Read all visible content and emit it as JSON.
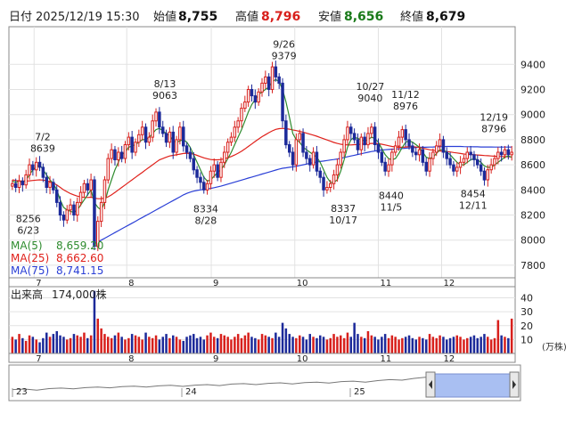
{
  "header": {
    "date_label": "日付",
    "datetime": "2025/12/19 15:30",
    "open_label": "始値",
    "open": "8,755",
    "high_label": "高値",
    "high": "8,796",
    "low_label": "安値",
    "low": "8,656",
    "close_label": "終値",
    "close": "8,679"
  },
  "colors": {
    "up": "#d8201c",
    "down": "#1c2a9a",
    "ma5": "#2e8b2e",
    "ma25": "#e0201a",
    "ma75": "#2a3fd6",
    "high": "#d8201c",
    "low": "#1a7a1a",
    "navigator_fill": "#a9bff2"
  },
  "legend": {
    "ma5": {
      "label": "MA(5)",
      "value": "8,659.20"
    },
    "ma25": {
      "label": "MA(25)",
      "value": "8,662.60"
    },
    "ma75": {
      "label": "MA(75)",
      "value": "8,741.15"
    }
  },
  "volume_panel": {
    "title": "出来高",
    "value": "174,000株",
    "unit": "(万株)",
    "y_ticks": [
      "40",
      "30",
      "20",
      "10"
    ]
  },
  "chart_data": {
    "type": "candlestick",
    "title": "",
    "xlabel": "",
    "ylabel": "",
    "ylim": [
      7700,
      9700
    ],
    "y_ticks": [
      7800,
      8000,
      8200,
      8400,
      8600,
      8800,
      9000,
      9200,
      9400
    ],
    "x_month_ticks": [
      "7",
      "8",
      "9",
      "10",
      "11",
      "12"
    ],
    "navigator_year_ticks": [
      "23",
      "24",
      "25"
    ],
    "annotations": [
      {
        "date": "6/23",
        "value": "8256",
        "position": "below"
      },
      {
        "date": "7/2",
        "value": "8639",
        "position": "above"
      },
      {
        "date": "8/13",
        "value": "9063",
        "position": "above"
      },
      {
        "date": "8/28",
        "value": "8334",
        "position": "below"
      },
      {
        "date": "9/26",
        "value": "9379",
        "position": "above"
      },
      {
        "date": "10/17",
        "value": "8337",
        "position": "below"
      },
      {
        "date": "10/27",
        "value": "9040",
        "position": "above"
      },
      {
        "date": "11/5",
        "value": "8440",
        "position": "below"
      },
      {
        "date": "11/12",
        "value": "8976",
        "position": "above"
      },
      {
        "date": "12/11",
        "value": "8454",
        "position": "below"
      },
      {
        "date": "12/19",
        "value": "8796",
        "position": "above"
      }
    ],
    "close_series": [
      8450,
      8420,
      8470,
      8440,
      8520,
      8600,
      8560,
      8620,
      8580,
      8500,
      8420,
      8460,
      8400,
      8300,
      8200,
      8160,
      8240,
      8280,
      8200,
      8300,
      8380,
      8450,
      8400,
      8480,
      7950,
      8150,
      8300,
      8480,
      8650,
      8720,
      8640,
      8700,
      8650,
      8760,
      8820,
      8700,
      8780,
      8840,
      8900,
      8780,
      8820,
      8950,
      9020,
      8900,
      8850,
      8780,
      8860,
      8700,
      8800,
      8900,
      8750,
      8700,
      8650,
      8560,
      8500,
      8460,
      8400,
      8450,
      8550,
      8600,
      8500,
      8620,
      8700,
      8780,
      8820,
      8900,
      8950,
      9050,
      9100,
      9200,
      9150,
      9100,
      9180,
      9250,
      9300,
      9200,
      9380,
      9300,
      9250,
      8950,
      8760,
      8700,
      8600,
      8800,
      8850,
      8700,
      8650,
      8600,
      8700,
      8550,
      8500,
      8400,
      8420,
      8450,
      8520,
      8600,
      8700,
      8800,
      8900,
      8850,
      8800,
      8720,
      8820,
      8760,
      8850,
      8900,
      8760,
      8700,
      8620,
      8550,
      8600,
      8700,
      8750,
      8820,
      8880,
      8800,
      8750,
      8700,
      8680,
      8720,
      8620,
      8550,
      8650,
      8700,
      8750,
      8800,
      8700,
      8650,
      8600,
      8550,
      8580,
      8620,
      8650,
      8700,
      8680,
      8640,
      8600,
      8550,
      8480,
      8560,
      8600,
      8650,
      8700,
      8680,
      8720,
      8680,
      8700
    ],
    "ma5_series": [
      8470,
      8460,
      8470,
      8460,
      8480,
      8520,
      8560,
      8580,
      8600,
      8560,
      8520,
      8480,
      8450,
      8400,
      8320,
      8260,
      8240,
      8230,
      8220,
      8240,
      8280,
      8320,
      8360,
      8400,
      8300,
      8260,
      8240,
      8300,
      8400,
      8480,
      8560,
      8620,
      8680,
      8700,
      8740,
      8750,
      8760,
      8780,
      8800,
      8800,
      8820,
      8850,
      8880,
      8890,
      8870,
      8850,
      8830,
      8790,
      8780,
      8790,
      8800,
      8780,
      8740,
      8680,
      8620,
      8560,
      8500,
      8470,
      8480,
      8510,
      8540,
      8560,
      8600,
      8650,
      8700,
      8760,
      8820,
      8880,
      8950,
      9020,
      9080,
      9120,
      9160,
      9180,
      9200,
      9220,
      9260,
      9280,
      9260,
      9200,
      9100,
      8980,
      8850,
      8800,
      8780,
      8740,
      8720,
      8700,
      8680,
      8660,
      8620,
      8560,
      8500,
      8460,
      8460,
      8480,
      8550,
      8640,
      8740,
      8800,
      8820,
      8810,
      8800,
      8790,
      8800,
      8820,
      8810,
      8780,
      8730,
      8680,
      8650,
      8640,
      8650,
      8690,
      8740,
      8780,
      8790,
      8780,
      8760,
      8740,
      8700,
      8660,
      8650,
      8660,
      8690,
      8720,
      8720,
      8700,
      8680,
      8650,
      8620,
      8600,
      8600,
      8620,
      8640,
      8650,
      8640,
      8620,
      8590,
      8580,
      8580,
      8600,
      8620,
      8640,
      8660,
      8670,
      8659
    ],
    "ma25_series": [
      8480,
      8475,
      8472,
      8470,
      8470,
      8472,
      8475,
      8478,
      8480,
      8478,
      8472,
      8465,
      8455,
      8440,
      8420,
      8400,
      8385,
      8370,
      8360,
      8350,
      8345,
      8340,
      8340,
      8342,
      8335,
      8330,
      8330,
      8335,
      8345,
      8360,
      8380,
      8400,
      8420,
      8440,
      8460,
      8480,
      8500,
      8520,
      8540,
      8560,
      8580,
      8600,
      8620,
      8640,
      8650,
      8660,
      8670,
      8675,
      8680,
      8685,
      8690,
      8692,
      8690,
      8685,
      8675,
      8665,
      8655,
      8648,
      8642,
      8640,
      8640,
      8642,
      8648,
      8656,
      8666,
      8678,
      8692,
      8708,
      8726,
      8746,
      8766,
      8786,
      8806,
      8824,
      8840,
      8856,
      8870,
      8882,
      8888,
      8890,
      8888,
      8884,
      8878,
      8872,
      8866,
      8860,
      8852,
      8844,
      8836,
      8828,
      8818,
      8808,
      8798,
      8788,
      8778,
      8770,
      8764,
      8760,
      8758,
      8758,
      8760,
      8762,
      8764,
      8766,
      8768,
      8770,
      8770,
      8768,
      8764,
      8758,
      8752,
      8746,
      8742,
      8740,
      8740,
      8742,
      8744,
      8744,
      8742,
      8738,
      8732,
      8726,
      8720,
      8716,
      8712,
      8710,
      8708,
      8706,
      8702,
      8698,
      8694,
      8690,
      8686,
      8684,
      8682,
      8680,
      8678,
      8676,
      8674,
      8672,
      8670,
      8668,
      8667,
      8666,
      8665,
      8664,
      8663
    ],
    "ma75_series": [
      null,
      null,
      null,
      null,
      null,
      null,
      null,
      null,
      null,
      null,
      null,
      null,
      null,
      null,
      null,
      null,
      null,
      null,
      null,
      null,
      null,
      null,
      null,
      null,
      7970,
      7985,
      8000,
      8015,
      8030,
      8045,
      8060,
      8075,
      8090,
      8105,
      8120,
      8135,
      8150,
      8165,
      8180,
      8195,
      8210,
      8225,
      8240,
      8255,
      8270,
      8285,
      8300,
      8315,
      8330,
      8345,
      8360,
      8372,
      8382,
      8390,
      8396,
      8400,
      8404,
      8408,
      8412,
      8418,
      8424,
      8430,
      8438,
      8446,
      8454,
      8462,
      8470,
      8478,
      8486,
      8494,
      8502,
      8510,
      8518,
      8526,
      8534,
      8542,
      8550,
      8558,
      8566,
      8572,
      8576,
      8580,
      8584,
      8588,
      8594,
      8600,
      8606,
      8612,
      8618,
      8622,
      8626,
      8630,
      8634,
      8638,
      8642,
      8646,
      8652,
      8658,
      8664,
      8670,
      8676,
      8682,
      8688,
      8694,
      8700,
      8706,
      8710,
      8714,
      8718,
      8720,
      8722,
      8724,
      8726,
      8728,
      8730,
      8732,
      8734,
      8736,
      8738,
      8740,
      8740,
      8740,
      8741,
      8742,
      8743,
      8744,
      8745,
      8746,
      8746,
      8746,
      8746,
      8746,
      8745,
      8744,
      8744,
      8743,
      8743,
      8742,
      8742,
      8742,
      8742,
      8741,
      8741,
      8741,
      8741,
      8741,
      8741
    ],
    "volume_series": [
      12,
      10,
      14,
      11,
      9,
      13,
      12,
      10,
      8,
      11,
      15,
      12,
      14,
      16,
      13,
      12,
      10,
      11,
      14,
      13,
      12,
      15,
      11,
      13,
      45,
      25,
      18,
      14,
      12,
      11,
      13,
      15,
      12,
      10,
      11,
      14,
      13,
      12,
      10,
      15,
      12,
      11,
      13,
      10,
      12,
      14,
      11,
      13,
      12,
      10,
      9,
      12,
      13,
      14,
      11,
      12,
      10,
      13,
      15,
      12,
      11,
      14,
      13,
      12,
      10,
      12,
      14,
      11,
      13,
      15,
      12,
      11,
      10,
      14,
      13,
      12,
      11,
      15,
      12,
      22,
      18,
      14,
      12,
      11,
      13,
      12,
      10,
      14,
      12,
      11,
      13,
      12,
      10,
      11,
      14,
      12,
      13,
      11,
      15,
      12,
      22,
      14,
      12,
      11,
      16,
      13,
      12,
      10,
      12,
      14,
      11,
      13,
      12,
      10,
      11,
      12,
      13,
      11,
      10,
      12,
      11,
      10,
      14,
      12,
      11,
      13,
      12,
      10,
      11,
      12,
      13,
      12,
      10,
      11,
      12,
      13,
      11,
      12,
      14,
      12,
      10,
      11,
      24,
      13,
      12,
      11,
      25
    ],
    "navigator_series": [
      0.3,
      0.32,
      0.28,
      0.34,
      0.36,
      0.33,
      0.38,
      0.4,
      0.37,
      0.42,
      0.44,
      0.4,
      0.45,
      0.47,
      0.43,
      0.48,
      0.5,
      0.46,
      0.52,
      0.54,
      0.5,
      0.55,
      0.57,
      0.53,
      0.58,
      0.6,
      0.56,
      0.62,
      0.64,
      0.6,
      0.66,
      0.7,
      0.68,
      0.75,
      0.8,
      0.78,
      0.82,
      0.85,
      0.88,
      0.86,
      0.84,
      0.86
    ]
  }
}
